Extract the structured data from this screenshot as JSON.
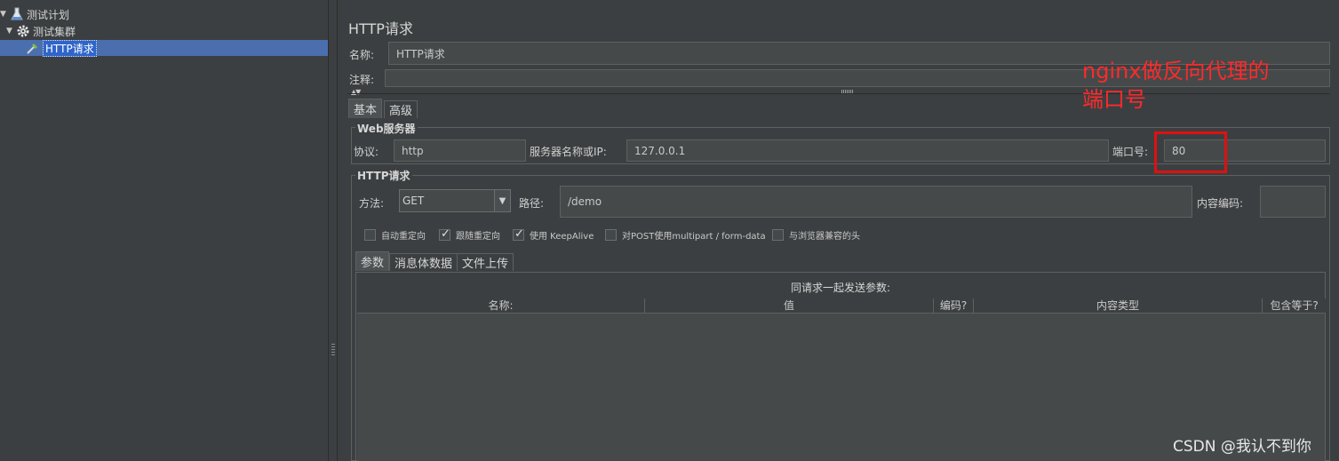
{
  "tree": {
    "plan_label": "测试计划",
    "group_label": "测试集群",
    "sampler_label": "HTTP请求"
  },
  "panel": {
    "title": "HTTP请求",
    "name_label": "名称:",
    "name_value": "HTTP请求",
    "comment_label": "注释:",
    "comment_value": ""
  },
  "tabs": [
    "基本",
    "高级"
  ],
  "web_server": {
    "title": "Web服务器",
    "protocol_label": "协议:",
    "protocol_value": "http",
    "server_label": "服务器名称或IP:",
    "server_value": "127.0.0.1",
    "port_label": "端口号:",
    "port_value": "80"
  },
  "http_request": {
    "title": "HTTP请求",
    "method_label": "方法:",
    "method_value": "GET",
    "path_label": "路径:",
    "path_value": "/demo",
    "encoding_label": "内容编码:",
    "encoding_value": ""
  },
  "options": [
    {
      "label": "自动重定向",
      "checked": false
    },
    {
      "label": "跟随重定向",
      "checked": true
    },
    {
      "label": "使用 KeepAlive",
      "checked": true
    },
    {
      "label": "对POST使用multipart / form-data",
      "checked": false
    },
    {
      "label": "与浏览器兼容的头",
      "checked": false
    }
  ],
  "sub_tabs": [
    "参数",
    "消息体数据",
    "文件上传"
  ],
  "params_table": {
    "caption": "同请求一起发送参数:",
    "columns": [
      "名称:",
      "值",
      "编码?",
      "内容类型",
      "包含等于?"
    ]
  },
  "annotation": {
    "line1": "nginx做反向代理的",
    "line2": "端口号",
    "color": "#ff2a2a"
  },
  "watermark": "CSDN @我认不到你",
  "colors": {
    "background": "#3c3f41",
    "selection": "#4b6eaf",
    "field": "#45494a"
  }
}
